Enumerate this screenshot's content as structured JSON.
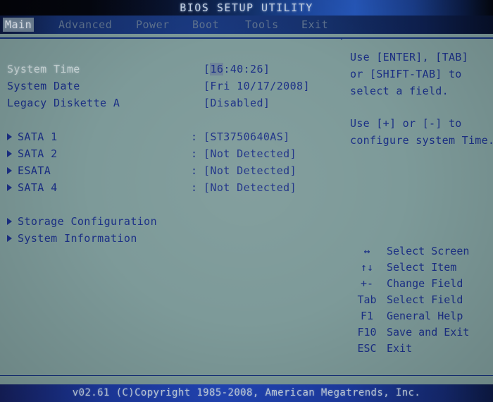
{
  "titlebar": {
    "title": "BIOS SETUP UTILITY"
  },
  "menubar": {
    "items": [
      {
        "label": "Main",
        "active": true
      },
      {
        "label": "Advanced",
        "active": false
      },
      {
        "label": "Power",
        "active": false
      },
      {
        "label": "Boot",
        "active": false
      },
      {
        "label": "Tools",
        "active": false
      },
      {
        "label": "Exit",
        "active": false
      }
    ]
  },
  "main": {
    "settings": [
      {
        "label": "System Time",
        "value": "[16:40:26]",
        "cursor": "16",
        "selected": true
      },
      {
        "label": "System Date",
        "value": "[Fri 10/17/2008]",
        "selected": false
      },
      {
        "label": "Legacy Diskette A",
        "value": "[Disabled]",
        "selected": false
      }
    ],
    "drives": [
      {
        "label": "SATA 1",
        "separator": ":",
        "value": "[ST3750640AS]"
      },
      {
        "label": "SATA 2",
        "separator": ":",
        "value": "[Not Detected]"
      },
      {
        "label": "ESATA",
        "separator": ":",
        "value": "[Not Detected]"
      },
      {
        "label": "SATA 4",
        "separator": ":",
        "value": "[Not Detected]"
      }
    ],
    "submenus": [
      {
        "label": "Storage Configuration"
      },
      {
        "label": "System Information"
      }
    ]
  },
  "help": {
    "lines": [
      "Use [ENTER], [TAB]",
      "or [SHIFT-TAB] to",
      "select a field.",
      "",
      "Use [+] or [-] to",
      "configure system Time."
    ]
  },
  "navkeys": [
    {
      "key": "↔",
      "desc": "Select Screen"
    },
    {
      "key": "↑↓",
      "desc": "Select Item"
    },
    {
      "key": "+-",
      "desc": "Change Field"
    },
    {
      "key": "Tab",
      "desc": "Select Field"
    },
    {
      "key": "F1",
      "desc": "General Help"
    },
    {
      "key": "F10",
      "desc": "Save and Exit"
    },
    {
      "key": "ESC",
      "desc": "Exit"
    }
  ],
  "footer": {
    "text": "v02.61 (C)Copyright 1985-2008, American Megatrends, Inc."
  },
  "colors": {
    "screen_bg": "#7d9a99",
    "text_blue": "#1b2f86",
    "text_selected": "#cdd9da",
    "frame_line": "#15307a",
    "titlebar_blue": "#2759bd",
    "footer_blue": "#2246b8",
    "highlight_bg": "#6f8397"
  }
}
